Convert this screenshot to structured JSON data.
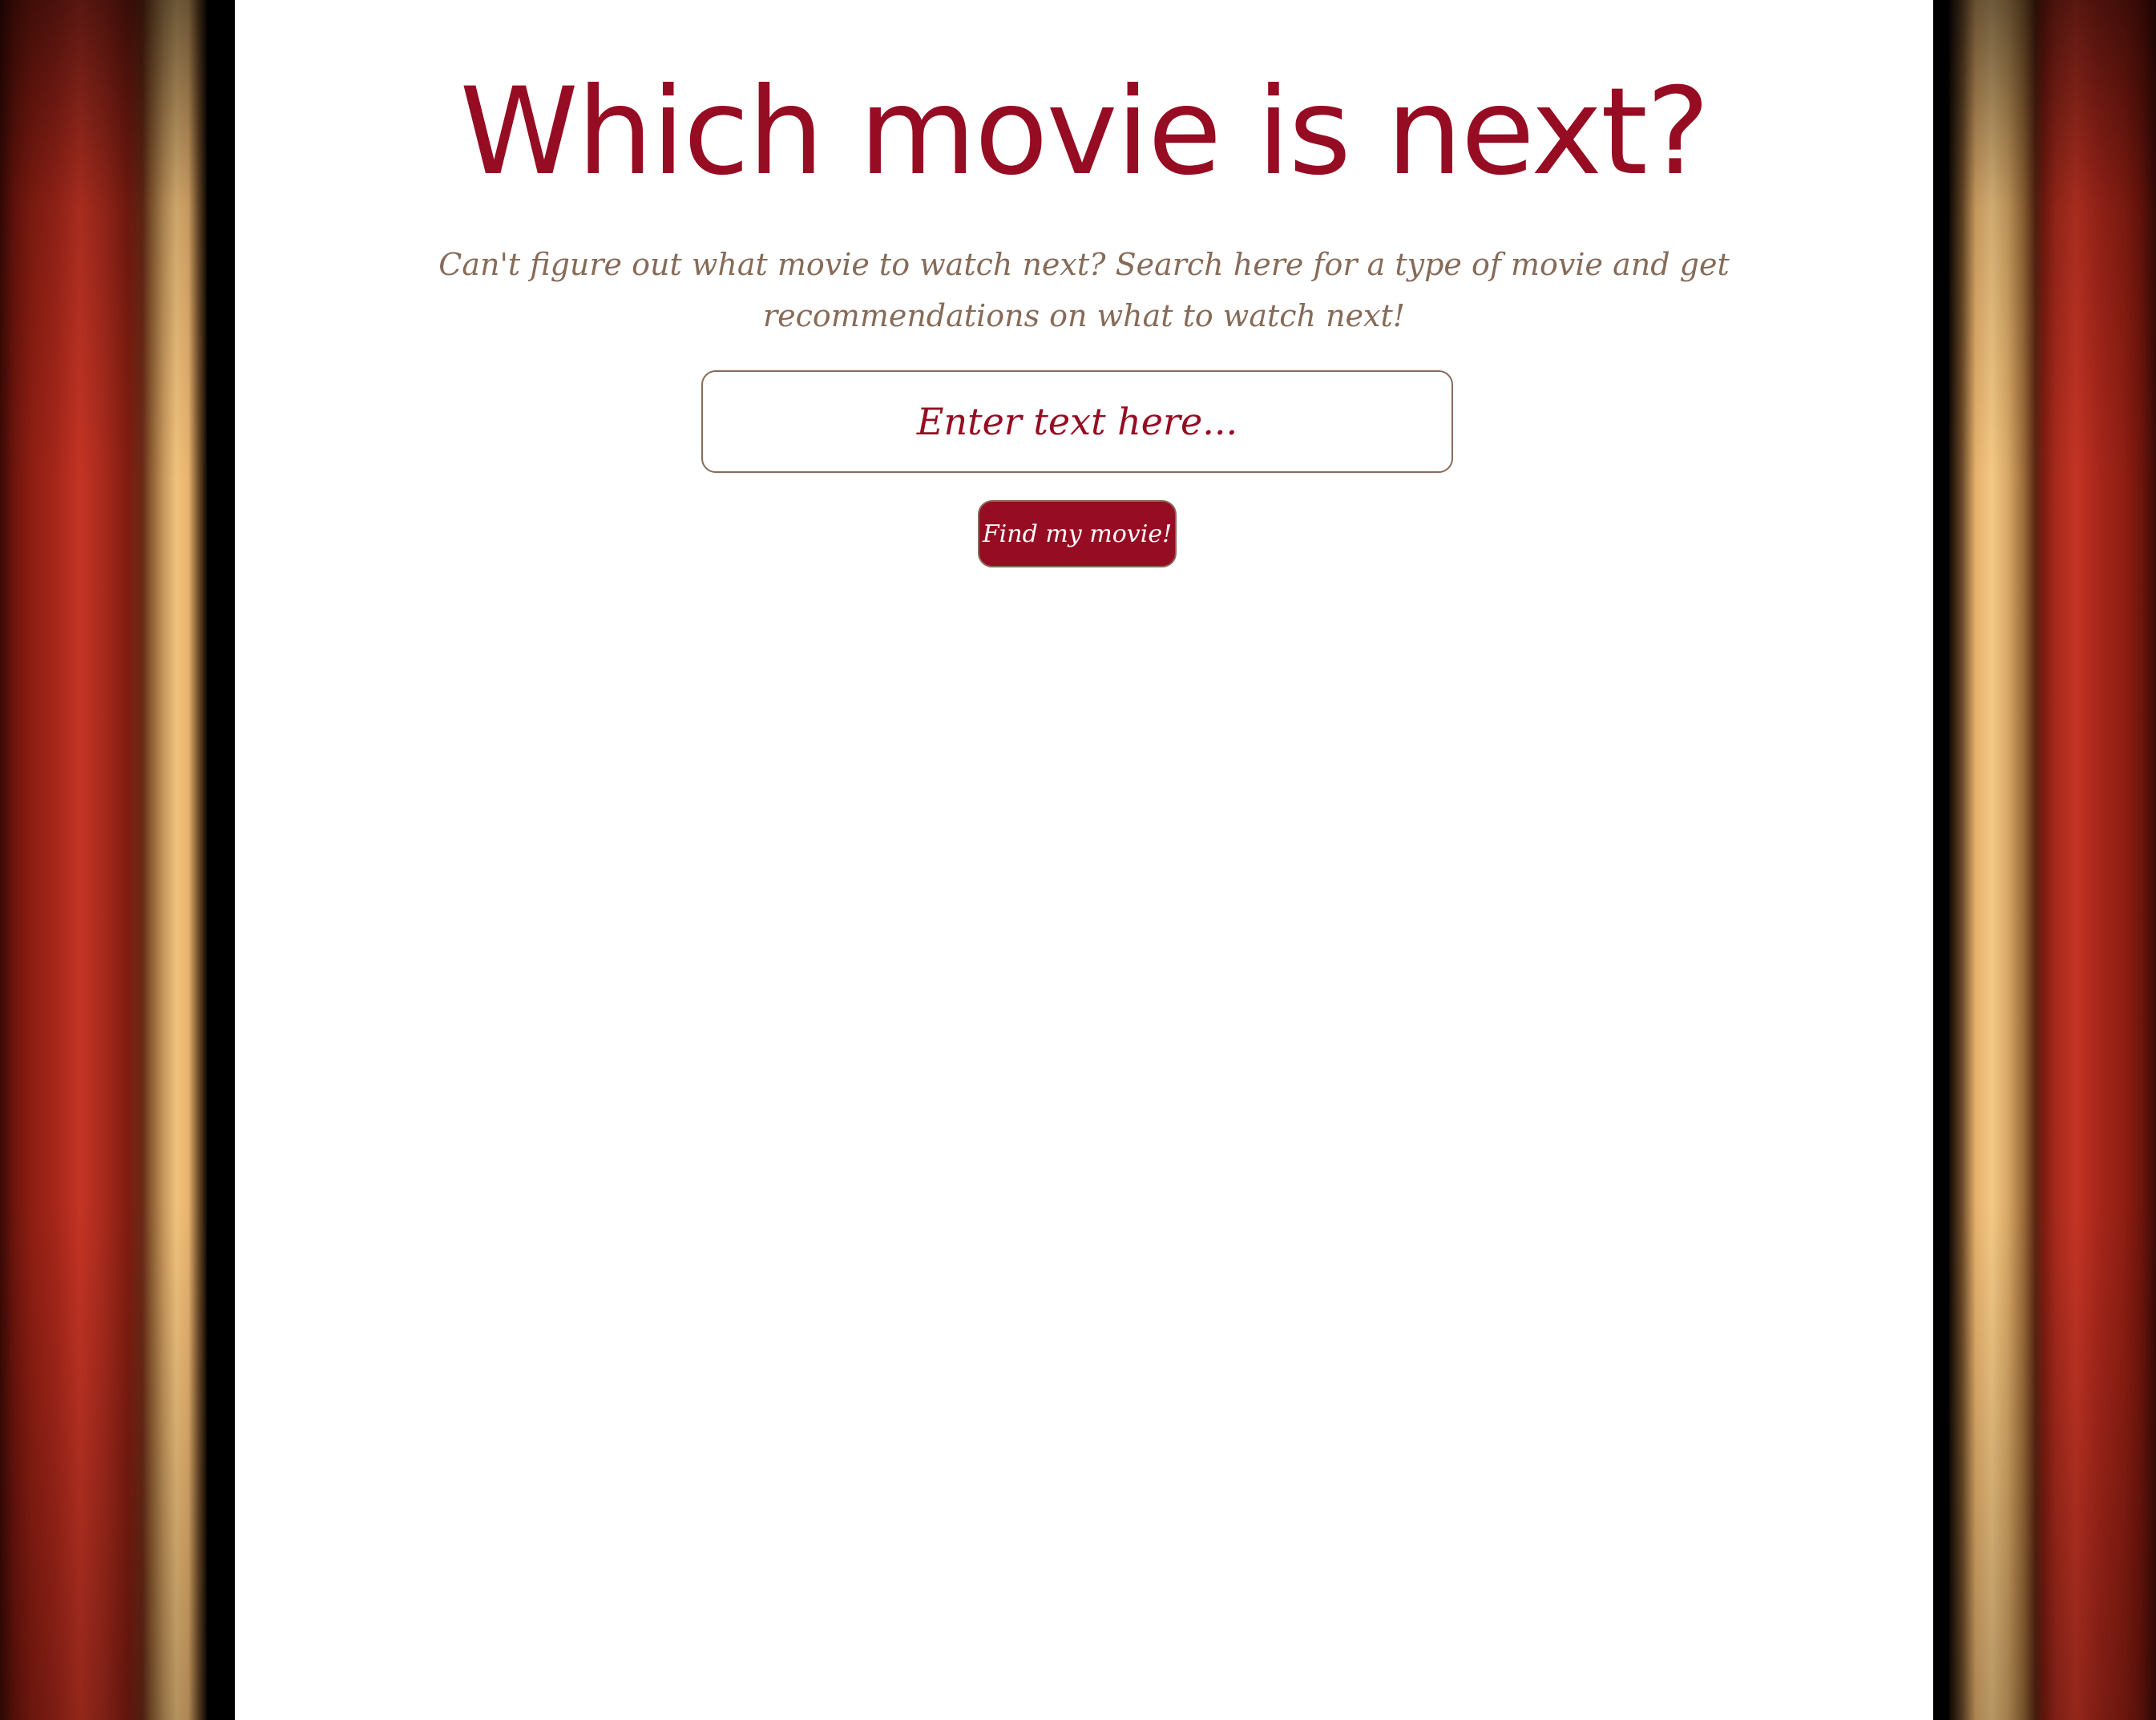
{
  "page": {
    "title": "Which movie is next?",
    "subtitle": "Can't figure out what movie to watch next? Search here for a type of movie and get recommendations on what to watch next!"
  },
  "search": {
    "placeholder": "Enter text here...",
    "value": ""
  },
  "actions": {
    "find_label": "Find my movie!"
  },
  "colors": {
    "accent": "#960c22",
    "muted_text": "#866b58",
    "background": "#ffffff",
    "curtain": "#a6261a"
  }
}
